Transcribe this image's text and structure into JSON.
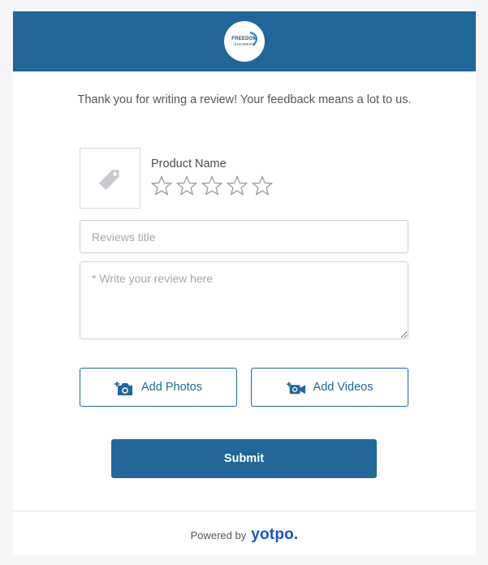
{
  "header": {
    "logo_line1": "FREEDOM",
    "logo_line2": "SHOWERS",
    "background_color": "#216799"
  },
  "intro": {
    "thanks_text": "Thank you for writing a review! Your feedback means a lot to us."
  },
  "product": {
    "name": "Product Name",
    "thumbnail_icon": "price-tag-icon",
    "rating": 0,
    "max_rating": 5
  },
  "form": {
    "title_placeholder": "Reviews title",
    "title_value": "",
    "review_placeholder": "* Write your review here",
    "review_value": ""
  },
  "media": {
    "add_photos_label": "Add Photos",
    "add_photos_icon": "add-photo-camera-icon",
    "add_videos_label": "Add Videos",
    "add_videos_icon": "add-video-camera-icon"
  },
  "actions": {
    "submit_label": "Submit",
    "accent_color": "#216799"
  },
  "footer": {
    "powered_by": "Powered by",
    "brand": "yotpo.",
    "brand_color": "#1c4fd8"
  }
}
